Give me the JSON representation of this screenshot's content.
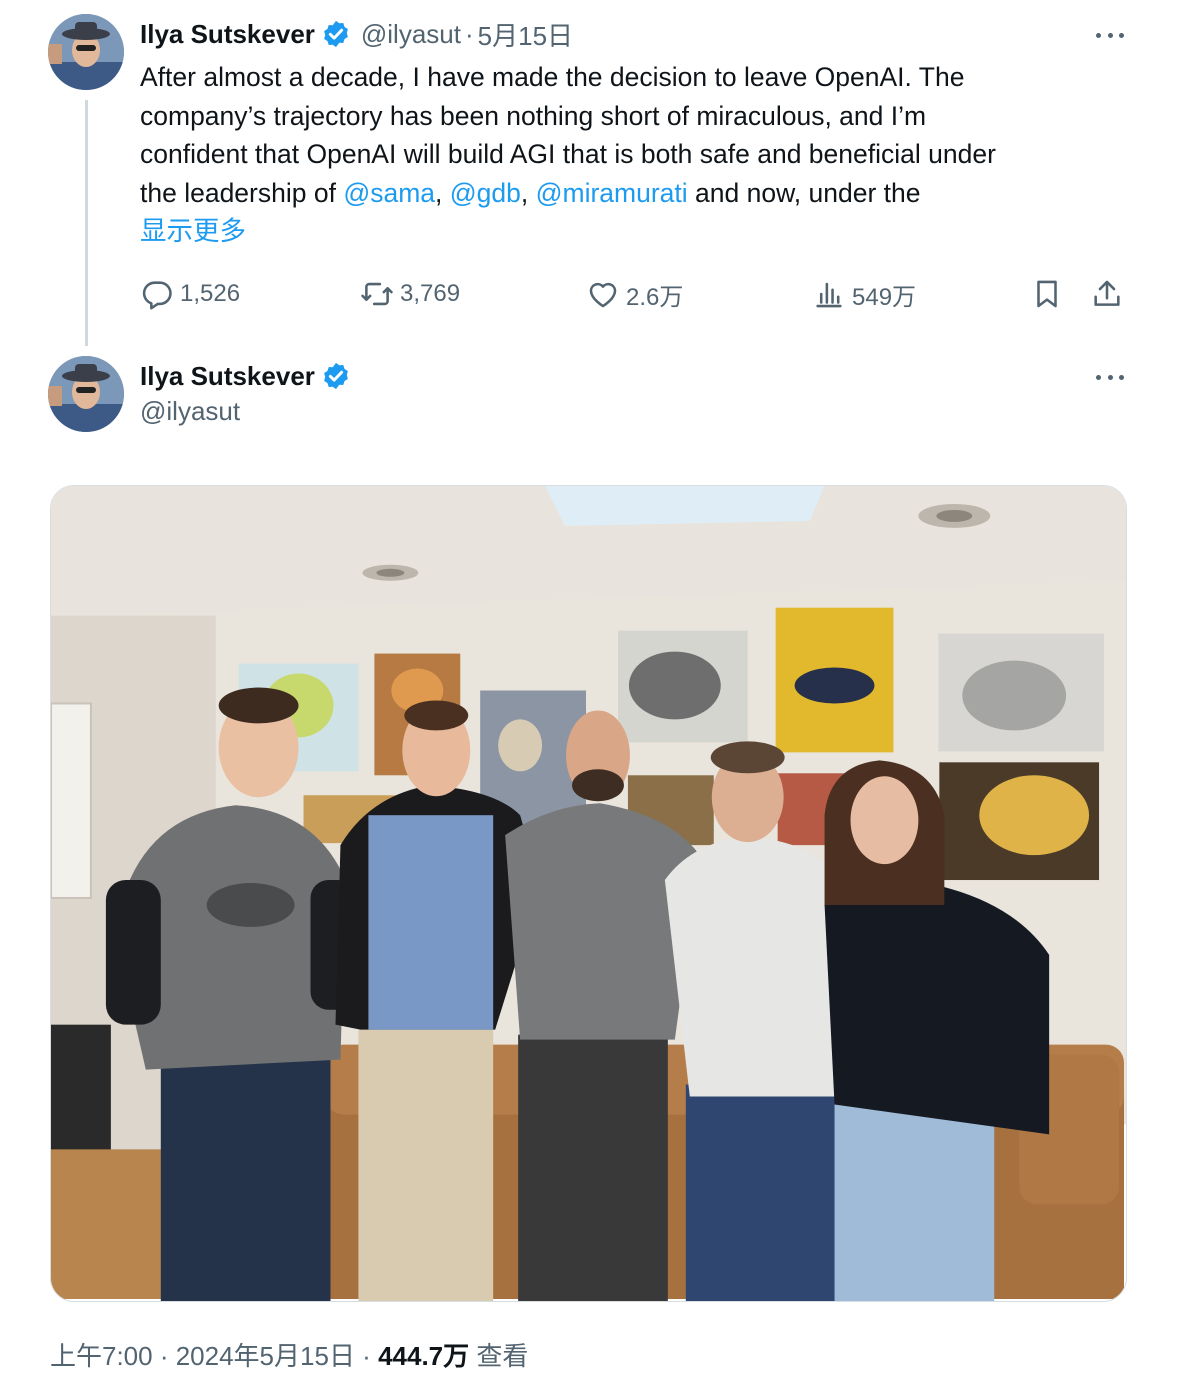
{
  "tweet1": {
    "display_name": "Ilya Sutskever",
    "handle": "@ilyasut",
    "separator": "·",
    "date": "5月15日",
    "text_line1": "After almost a decade, I have made the decision to leave OpenAI.  The",
    "text_line2": "company’s trajectory has been nothing short of miraculous, and I’m",
    "text_line3": "confident that OpenAI will build AGI that is both safe and beneficial under",
    "text_line4_prefix": "the leadership of ",
    "mention1": "@sama",
    "comma1": ", ",
    "mention2": "@gdb",
    "comma2": ", ",
    "mention3": "@miramurati",
    "text_line4_suffix": " and now, under the",
    "show_more": "显示更多",
    "replies": "1,526",
    "reposts": "3,769",
    "likes": "2.6万",
    "views": "549万"
  },
  "tweet2": {
    "display_name": "Ilya Sutskever",
    "handle": "@ilyasut",
    "meta_time": "上午7:00",
    "meta_sep1": " · ",
    "meta_date": "2024年5月15日",
    "meta_sep2": " · ",
    "meta_views": "444.7万",
    "meta_views_label": " 查看"
  },
  "icons": {
    "verified": "verified-badge-icon",
    "more": "more-icon",
    "reply": "reply-icon",
    "repost": "repost-icon",
    "like": "like-icon",
    "views": "views-icon",
    "bookmark": "bookmark-icon",
    "share": "share-icon"
  },
  "colors": {
    "link": "#1d9bf0",
    "secondary_text": "#536471",
    "primary_text": "#0f1419",
    "thread_line": "#cfd9de"
  }
}
